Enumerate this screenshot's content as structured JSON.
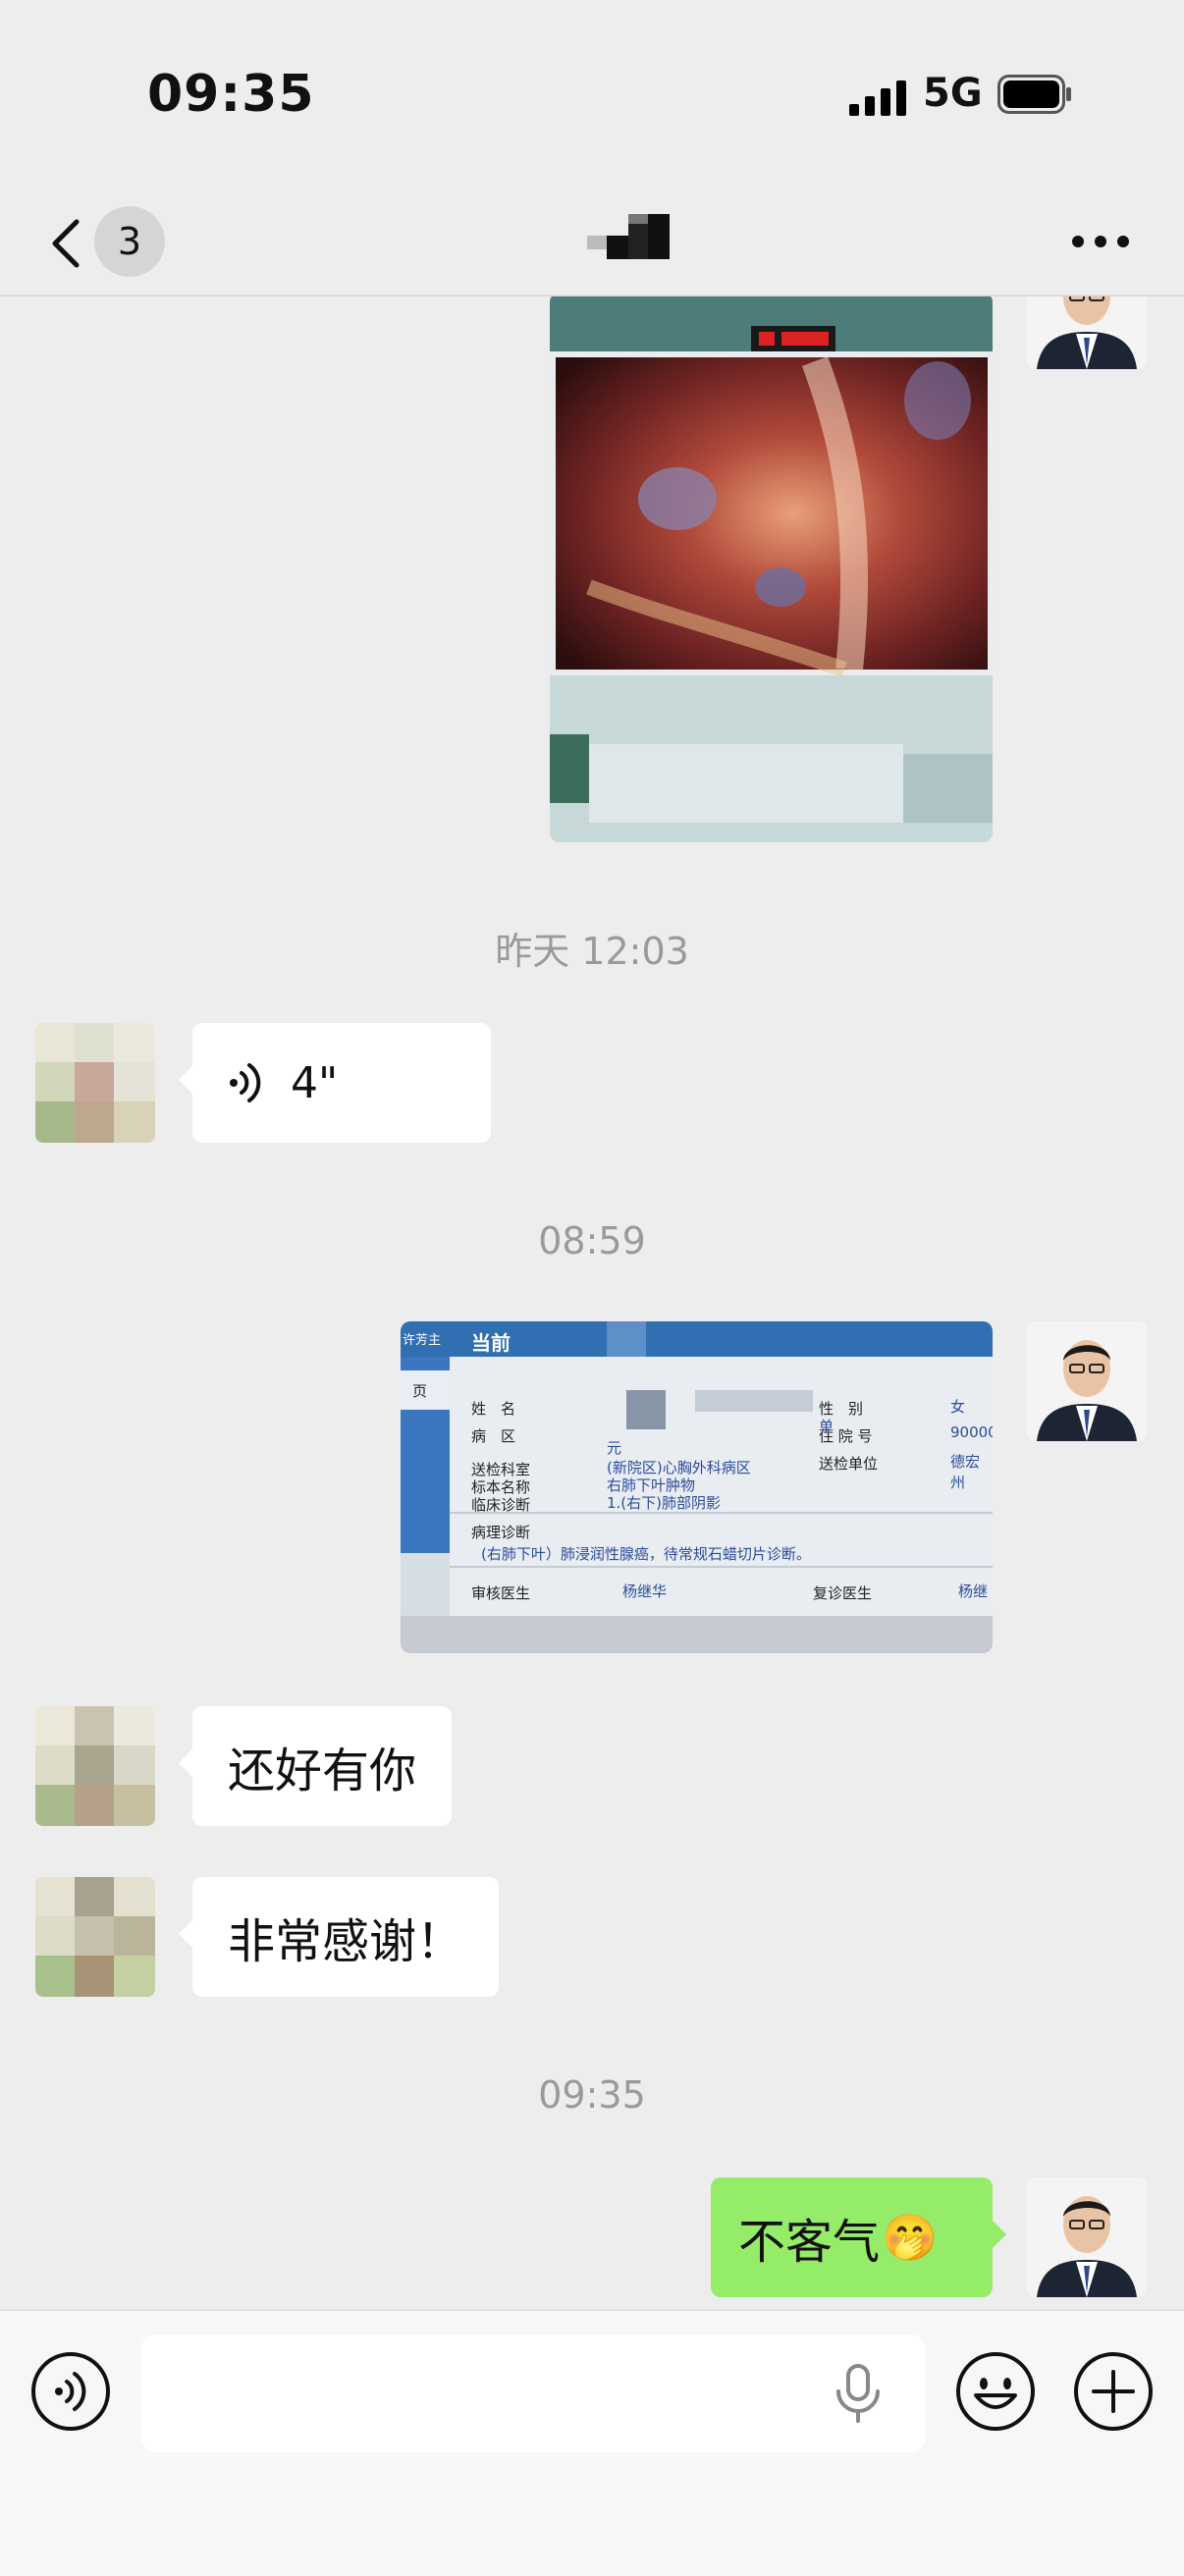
{
  "status_bar": {
    "time": "09:35",
    "network": "5G",
    "signal_icon": "cellular-signal-icon",
    "battery_icon": "battery-icon"
  },
  "nav": {
    "back_icon": "chevron-left-icon",
    "unread_count": "3",
    "title_icon": "pixelated-name",
    "more_icon": "more-dots-icon"
  },
  "messages": {
    "ts_yesterday": "昨天 12:03",
    "voice_duration": "4\"",
    "ts_0859": "08:59",
    "report_labels": {
      "name": "姓　名",
      "ward": "病　区",
      "dept": "送检科室",
      "specimen": "标本名称",
      "clinical": "临床诊断",
      "gender": "性　别",
      "gender_val": "女",
      "admission": "住 院 号",
      "admission_val": "90000",
      "unit": "送检单位",
      "unit_val": "德宏州",
      "ward_val": "元",
      "dept_val": "(新院区)心胸外科病区",
      "specimen_val": "右肺下叶肿物",
      "clinical_val": "1.(右下)肺部阴影",
      "path_title": "病理诊断",
      "path_text": "(右肺下叶）肺浸润性腺癌，待常规石蜡切片诊断。",
      "reviewer": "审核医生",
      "reviewer_val": "杨继华",
      "rechecker": "复诊医生",
      "rechecker_val": "杨继",
      "header_text": "当前",
      "side_tab": "许芳主",
      "side_page": "页",
      "doc_word": "单"
    },
    "msg_thanks1": "还好有你",
    "msg_thanks2": "非常感谢！",
    "ts_0935": "09:35",
    "msg_reply": "不客气",
    "reply_emoji": "🤭"
  },
  "input_bar": {
    "placeholder": "",
    "voice_icon": "voice-mode-icon",
    "mic_icon": "microphone-icon",
    "emoji_icon": "emoji-icon",
    "plus_icon": "plus-circle-icon"
  },
  "colors": {
    "background": "#ededed",
    "sent_bubble": "#95ec69",
    "received_bubble": "#ffffff",
    "timestamp": "#9a9a9a"
  }
}
